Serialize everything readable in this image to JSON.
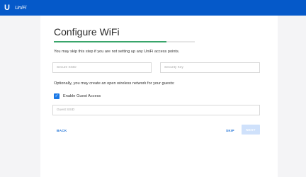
{
  "header": {
    "logo_mark": "U",
    "logo_text": "UniFi"
  },
  "wizard": {
    "title": "Configure WiFi",
    "progress": 0.8,
    "instruction": "You may skip this step if you are not setting up any UniFi access points.",
    "ssid_placeholder": "Secure SSID",
    "security_key_placeholder": "Security Key",
    "guest_prompt": "Optionally, you may create an open wireless network for your guests:",
    "guest_access_label": "Enable Guest Access",
    "guest_access_checked": true,
    "guest_ssid_placeholder": "Guest SSID",
    "back_label": "BACK",
    "skip_label": "SKIP",
    "next_label": "NEXT"
  },
  "colors": {
    "topbar": "#0559c9",
    "progress": "#3aa56b",
    "accent": "#1a78e6",
    "next_disabled": "#cfe1fb"
  },
  "icons": {
    "check": "checkmark-icon",
    "logo": "unifi-logo-icon"
  }
}
